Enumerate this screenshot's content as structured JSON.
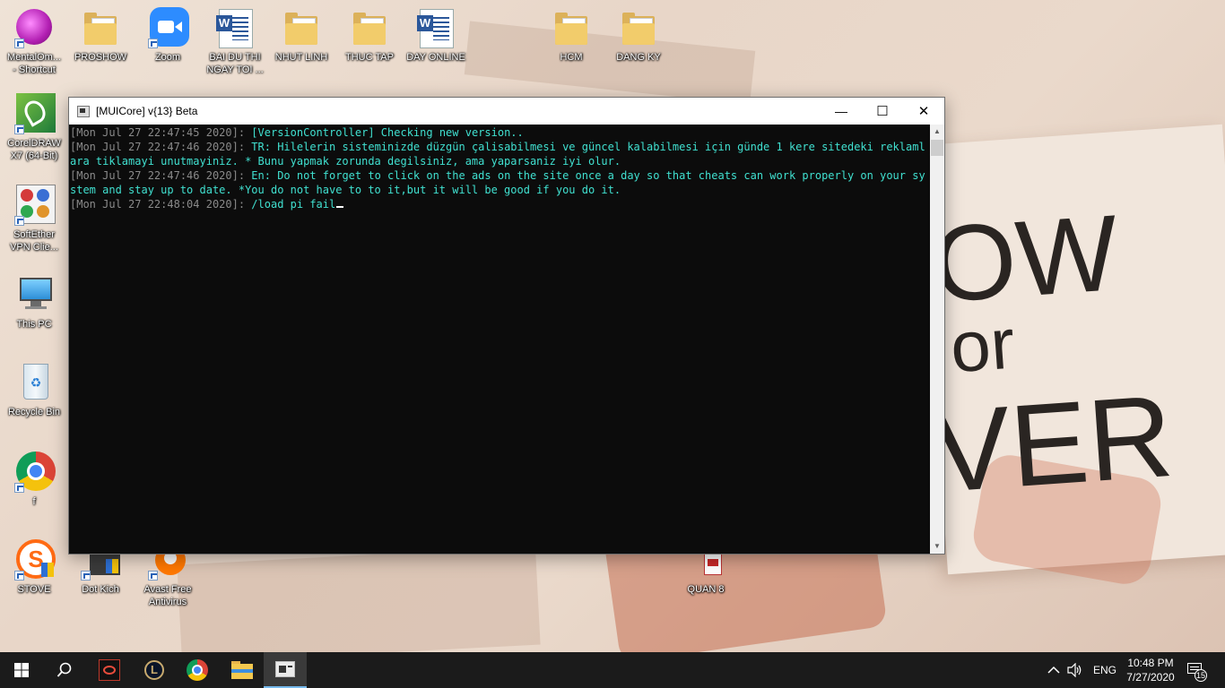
{
  "desktop": {
    "icons": [
      {
        "label": "MentalOm...\n- Shortcut"
      },
      {
        "label": "PROSHOW"
      },
      {
        "label": "Zoom"
      },
      {
        "label": "BAI DU THI\nNGAY TOI ..."
      },
      {
        "label": "NHUT LINH"
      },
      {
        "label": "THUC TAP"
      },
      {
        "label": "DAY ONLINE"
      },
      {
        "label": "HCM"
      },
      {
        "label": "DANG KY"
      },
      {
        "label": "CorelDRAW\nX7 (64-Bit)"
      },
      {
        "label": "SoftEther\nVPN Clie..."
      },
      {
        "label": "This PC"
      },
      {
        "label": "Recycle Bin"
      },
      {
        "label": "f"
      },
      {
        "label": "STOVE"
      },
      {
        "label": "Dot Kich"
      },
      {
        "label": "Avast Free\nAntivirus"
      },
      {
        "label": "QUAN 8"
      }
    ],
    "wallpaper_text": {
      "a": "OW",
      "b": "or",
      "c": "VER"
    }
  },
  "window": {
    "title": "[MUICore] v{13} Beta",
    "controls": {
      "minimize": "—",
      "maximize": "☐",
      "close": "✕"
    },
    "console_lines": [
      {
        "ts": "[Mon Jul 27 22:47:45 2020]:",
        "msg": " [VersionController] Checking new version.."
      },
      {
        "ts": "[Mon Jul 27 22:47:46 2020]:",
        "msg": " TR: Hilelerin sisteminizde düzgün çalisabilmesi ve güncel kalabilmesi için günde 1 kere sitedeki reklamlara tiklamayi unutmayiniz. * Bunu yapmak zorunda degilsiniz, ama yaparsaniz iyi olur."
      },
      {
        "ts": "[Mon Jul 27 22:47:46 2020]:",
        "msg": " En: Do not forget to click on the ads on the site once a day so that cheats can work properly on your system and stay up to date. *You do not have to to it,but it will be good if you do it."
      },
      {
        "ts": "[Mon Jul 27 22:48:04 2020]:",
        "msg": " /load pi fail"
      }
    ]
  },
  "taskbar": {
    "language": "ENG",
    "time": "10:48 PM",
    "date": "7/27/2020",
    "notifications": "15",
    "apps": [
      "start-icon",
      "search-icon",
      "garena-icon",
      "league-icon",
      "chrome-icon",
      "file-explorer-icon",
      "console-app-icon"
    ]
  },
  "colors": {
    "console_bg": "#0c0c0c",
    "console_text": "#40e0d0",
    "timestamp": "#8a8a8a",
    "taskbar": "#1b1b1b"
  }
}
